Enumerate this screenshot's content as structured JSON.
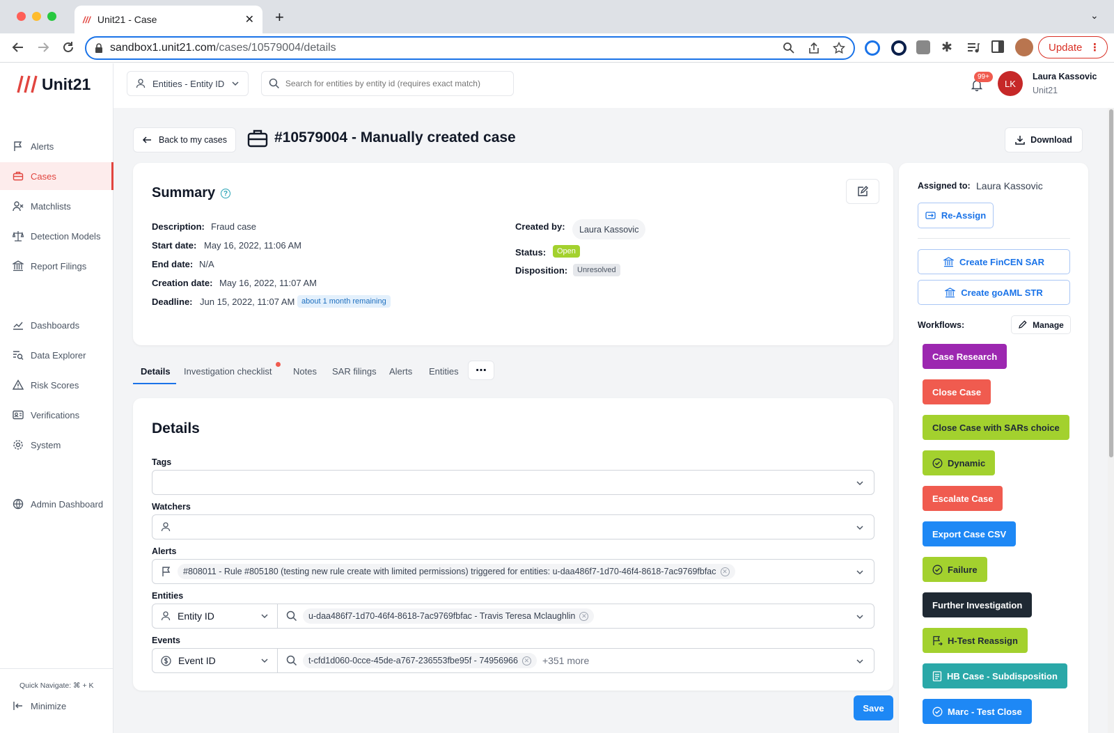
{
  "browser": {
    "tab_title": "Unit21 - Case",
    "url_host": "sandbox1.unit21.com",
    "url_path": "/cases/10579004/details",
    "update_label": "Update"
  },
  "app": {
    "logo_text": "Unit21",
    "entity_select": "Entities - Entity ID",
    "search_placeholder": "Search for entities by entity id (requires exact match)",
    "notif_badge": "99+",
    "user": {
      "initials": "LK",
      "name": "Laura Kassovic",
      "org": "Unit21"
    }
  },
  "sidebar": {
    "items": [
      {
        "label": "Alerts",
        "icon": "flag-icon"
      },
      {
        "label": "Cases",
        "icon": "briefcase-icon"
      },
      {
        "label": "Matchlists",
        "icon": "user-x-icon"
      },
      {
        "label": "Detection Models",
        "icon": "scale-icon"
      },
      {
        "label": "Report Filings",
        "icon": "bank-icon"
      },
      {
        "label": "Dashboards",
        "icon": "chart-line-icon"
      },
      {
        "label": "Data Explorer",
        "icon": "search-list-icon"
      },
      {
        "label": "Risk Scores",
        "icon": "warning-icon"
      },
      {
        "label": "Verifications",
        "icon": "id-card-icon"
      },
      {
        "label": "System",
        "icon": "gear-icon"
      },
      {
        "label": "Admin Dashboard",
        "icon": "globe-icon"
      }
    ],
    "quick_nav": "Quick Navigate: ⌘ + K",
    "minimize": "Minimize"
  },
  "case": {
    "back_label": "Back to my cases",
    "title": "#10579004 - Manually created case",
    "download_label": "Download"
  },
  "summary": {
    "heading": "Summary",
    "description_label": "Description:",
    "description": "Fraud case",
    "start_label": "Start date:",
    "start": "May 16, 2022, 11:06 AM",
    "end_label": "End date:",
    "end": "N/A",
    "creation_label": "Creation date:",
    "creation": "May 16, 2022, 11:07 AM",
    "deadline_label": "Deadline:",
    "deadline": "Jun 15, 2022, 11:07 AM",
    "deadline_badge": "about 1 month remaining",
    "created_by_label": "Created by:",
    "created_by": "Laura Kassovic",
    "status_label": "Status:",
    "status": "Open",
    "disposition_label": "Disposition:",
    "disposition": "Unresolved"
  },
  "tabs": [
    "Details",
    "Investigation checklist",
    "Notes",
    "SAR filings",
    "Alerts",
    "Entities"
  ],
  "details": {
    "heading": "Details",
    "tags_label": "Tags",
    "watchers_label": "Watchers",
    "alerts_label": "Alerts",
    "alert_chip": "#808011 - Rule #805180 (testing new rule create with limited permissions) triggered for entities: u-daa486f7-1d70-46f4-8618-7ac9769fbfac",
    "entities_label": "Entities",
    "entity_type": "Entity ID",
    "entity_chip": "u-daa486f7-1d70-46f4-8618-7ac9769fbfac - Travis Teresa Mclaughlin",
    "events_label": "Events",
    "event_type": "Event ID",
    "event_chip": "t-cfd1d060-0cce-45de-a767-236553fbe95f - 74956966",
    "event_more": "+351 more",
    "save_label": "Save"
  },
  "right_panel": {
    "assigned_label": "Assigned to:",
    "assigned": "Laura Kassovic",
    "reassign": "Re-Assign",
    "fincen": "Create FinCEN SAR",
    "goaml": "Create goAML STR",
    "workflows_label": "Workflows:",
    "manage": "Manage",
    "workflows": [
      {
        "label": "Case Research",
        "color": "#9c27b0"
      },
      {
        "label": "Close Case",
        "color": "#f05b4f"
      },
      {
        "label": "Close Case with SARs choice",
        "color": "#a3d12e"
      },
      {
        "label": "Dynamic",
        "color": "#a3d12e"
      },
      {
        "label": "Escalate Case",
        "color": "#f05b4f"
      },
      {
        "label": "Export Case CSV",
        "color": "#1e88f5"
      },
      {
        "label": "Failure",
        "color": "#a3d12e"
      },
      {
        "label": "Further Investigation",
        "color": "#1f2933"
      },
      {
        "label": "H-Test Reassign",
        "color": "#a3d12e"
      },
      {
        "label": "HB Case - Subdisposition",
        "color": "#2aa8a8"
      },
      {
        "label": "Marc - Test Close",
        "color": "#1e88f5"
      }
    ]
  }
}
